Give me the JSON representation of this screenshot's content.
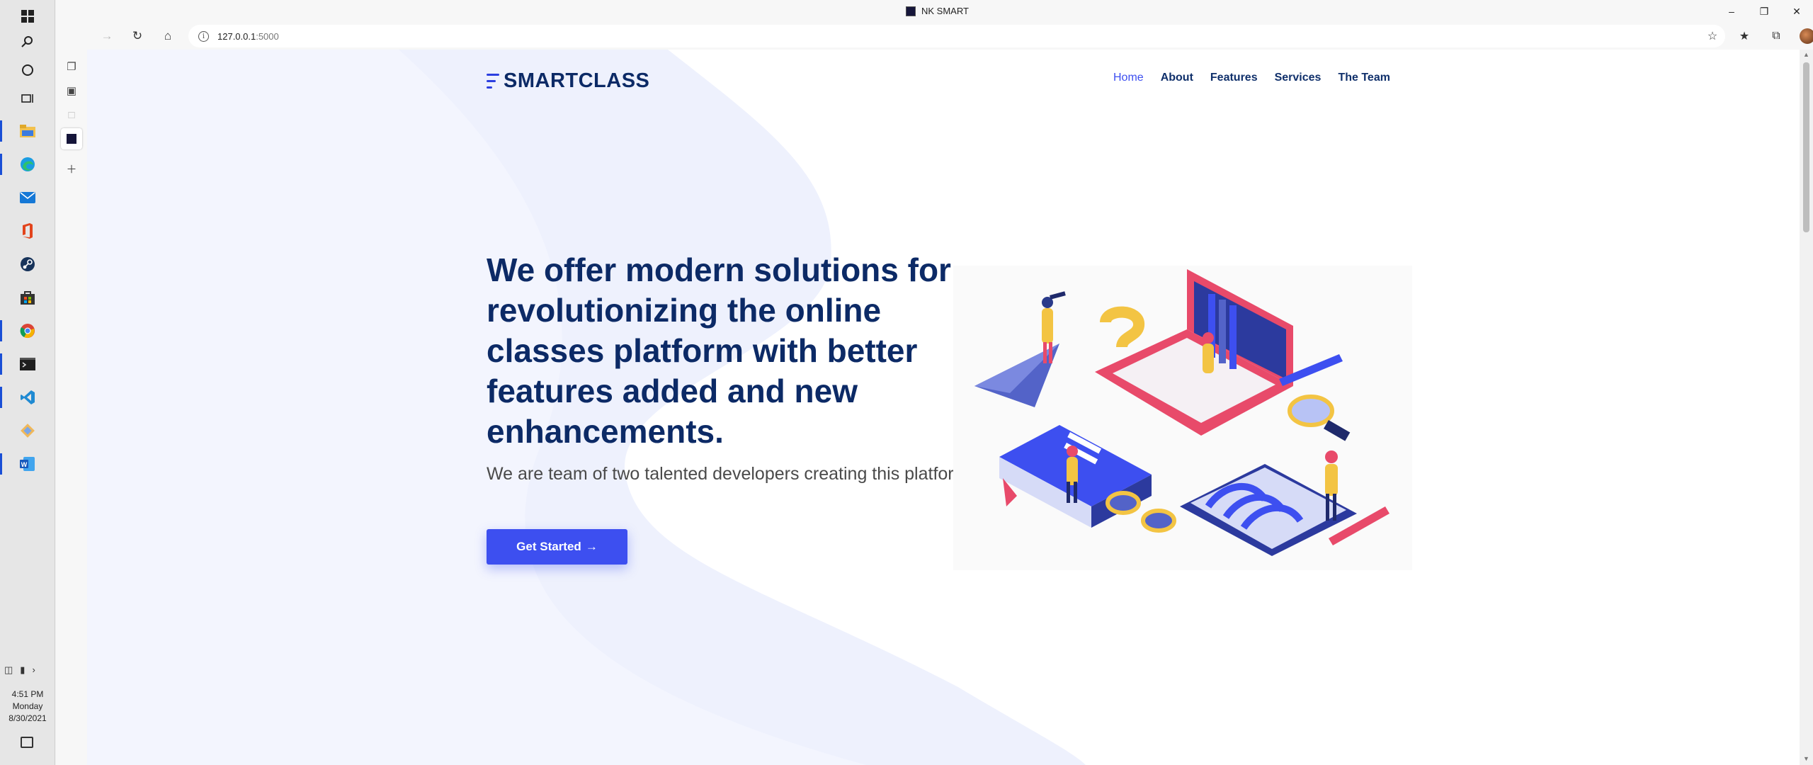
{
  "window": {
    "title": "NK SMART"
  },
  "taskbar": {
    "clock": {
      "time": "4:51 PM",
      "day": "Monday",
      "date": "8/30/2021"
    },
    "icons": [
      "windows-start-icon",
      "search-icon",
      "cortana-icon",
      "task-view-icon",
      "file-explorer-icon",
      "edge-icon",
      "mail-icon",
      "office-icon",
      "steam-icon",
      "store-icon",
      "chrome-icon",
      "terminal-icon",
      "vscode-icon",
      "git-icon",
      "word-icon"
    ]
  },
  "browser": {
    "url_host": "127.0.0.1",
    "url_port": ":5000"
  },
  "site": {
    "logo": "SMARTCLASS",
    "nav": [
      "Home",
      "About",
      "Features",
      "Services",
      "The Team"
    ],
    "hero": {
      "title": "We offer modern solutions for revolutionizing the online classes platform with better features added and new enhancements.",
      "subtitle": "We are team of two talented developers creating this platform.",
      "cta": "Get Started",
      "cta_arrow": "→"
    }
  },
  "colors": {
    "brand_dark": "#0c2a66",
    "accent": "#3d4ff0",
    "bg_light": "#eef1fd"
  }
}
